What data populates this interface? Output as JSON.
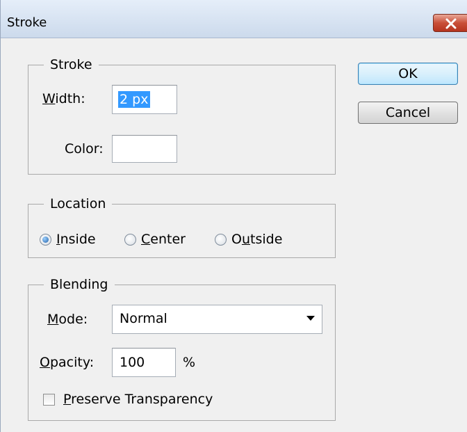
{
  "window": {
    "title": "Stroke"
  },
  "buttons": {
    "ok": "OK",
    "cancel": "Cancel"
  },
  "stroke": {
    "legend": "Stroke",
    "width_label_ul": "W",
    "width_label_rest": "idth:",
    "width_value": "2 px",
    "color_label": "Color:"
  },
  "location": {
    "legend": "Location",
    "options": [
      {
        "ul": "I",
        "rest": "nside",
        "checked": true
      },
      {
        "ul": "C",
        "rest": "enter",
        "checked": false
      },
      {
        "pre": "O",
        "ul": "u",
        "rest": "tside",
        "checked": false
      }
    ]
  },
  "blending": {
    "legend": "Blending",
    "mode_label_ul": "M",
    "mode_label_rest": "ode:",
    "mode_value": "Normal",
    "opacity_label_ul": "O",
    "opacity_label_rest": "pacity:",
    "opacity_value": "100",
    "opacity_unit": "%",
    "preserve_ul": "P",
    "preserve_rest": "reserve Transparency",
    "preserve_checked": false
  },
  "colors": {
    "titlebar": "#ccdaec",
    "selection": "#3399ff",
    "dialog_bg": "#f0f0f0"
  }
}
